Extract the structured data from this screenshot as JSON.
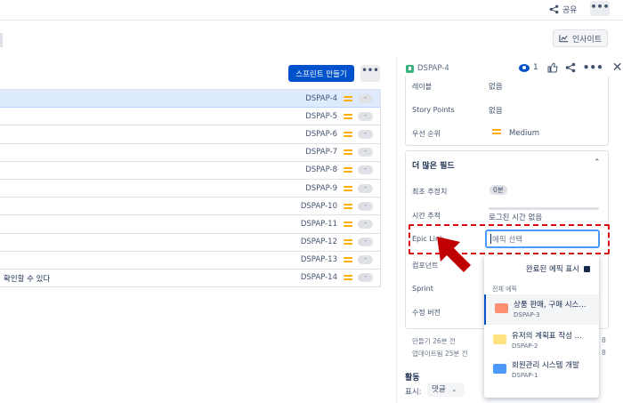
{
  "topbar": {
    "share_label": "공유",
    "more_label": "•••",
    "insight_label": "인사이트"
  },
  "backlog": {
    "create_sprint_label": "스프린트 만들기",
    "more_label": "•••",
    "rows": [
      {
        "summary": "",
        "key": "DSPAP-4",
        "badge": "-"
      },
      {
        "summary": "",
        "key": "DSPAP-5",
        "badge": "-"
      },
      {
        "summary": "",
        "key": "DSPAP-6",
        "badge": "-"
      },
      {
        "summary": "",
        "key": "DSPAP-7",
        "badge": "-"
      },
      {
        "summary": "",
        "key": "DSPAP-8",
        "badge": "-"
      },
      {
        "summary": "",
        "key": "DSPAP-9",
        "badge": "-"
      },
      {
        "summary": "",
        "key": "DSPAP-10",
        "badge": "-"
      },
      {
        "summary": "",
        "key": "DSPAP-11",
        "badge": "-"
      },
      {
        "summary": "",
        "key": "DSPAP-12",
        "badge": "-"
      },
      {
        "summary": "",
        "key": "DSPAP-13",
        "badge": "-"
      },
      {
        "summary": "확인할 수 있다",
        "key": "DSPAP-14",
        "badge": "-"
      }
    ]
  },
  "detail": {
    "issue_key": "DSPAP-4",
    "watch_count": "1",
    "fields": {
      "label_name": "레이블",
      "label_value": "없음",
      "sp_name": "Story Points",
      "sp_value": "없음",
      "priority_name": "우선 순위",
      "priority_value": "Medium"
    },
    "more_fields_title": "더 많은 필드",
    "more_fields": {
      "estimate_name": "최초 추정치",
      "estimate_value": "0분",
      "time_name": "시간 추적",
      "time_value": "로그된 시간 없음",
      "epic_name": "Epic Link",
      "epic_placeholder": "에픽 선택",
      "component_name": "컴포넌트",
      "sprint_name": "Sprint",
      "fix_name": "수정 버전"
    },
    "created": "만들기 26분 전",
    "updated": "업데이트됨 25분 전",
    "activity_title": "활동",
    "show_label": "표시:",
    "show_value": "댓글"
  },
  "epic_dropdown": {
    "toggle_label": "완료된 에픽 표시",
    "section_label": "전체 에픽",
    "items": [
      {
        "name": "상품 판매, 구매 시스...",
        "key": "DSPAP-3",
        "color": "#ff8f73"
      },
      {
        "name": "유저의 계획표 작성 ...",
        "key": "DSPAP-2",
        "color": "#ffe380"
      },
      {
        "name": "회원관리 시스템 개발",
        "key": "DSPAP-1",
        "color": "#4c9aff"
      }
    ]
  },
  "colors": {
    "primary": "#0052cc",
    "highlight": "#d6080f",
    "priority": "#ffab00"
  }
}
